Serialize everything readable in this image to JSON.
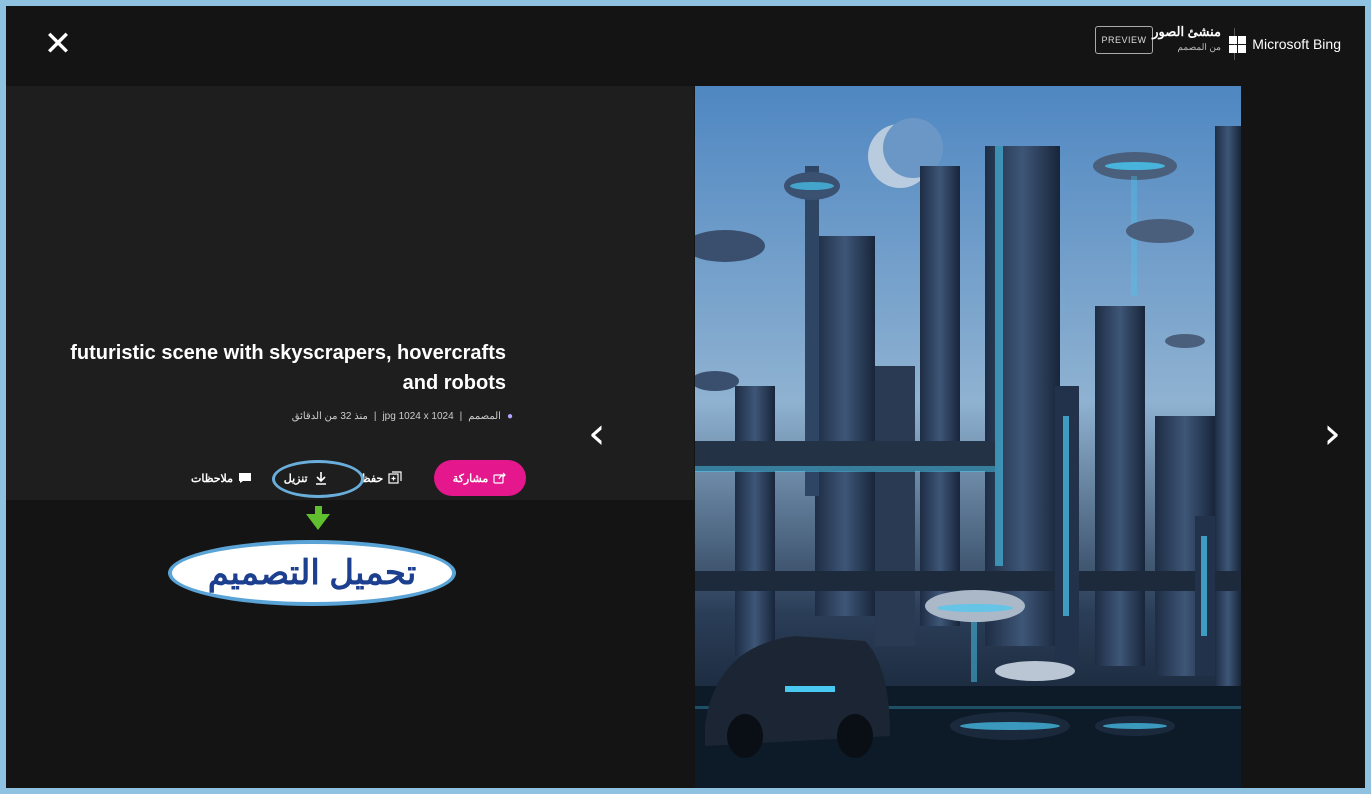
{
  "topbar": {
    "close_glyph": "✕",
    "brand_name": "Microsoft Bing",
    "gallery_title": "منشئ الصور",
    "gallery_subtitle": "من المصمم",
    "preview_label": "PREVIEW"
  },
  "details": {
    "title": "futuristic scene with skyscrapers, hovercrafts and robots",
    "meta": {
      "creator": "المصمم",
      "format": "jpg 1024 x 1024",
      "time": "منذ 32 من الدقائق"
    }
  },
  "actions": {
    "share_label": "مشاركة",
    "save_label": "حفظ",
    "download_label": "تنزيل",
    "feedback_label": "ملاحظات"
  },
  "annotation": {
    "callout_text": "تحميل التصميم"
  },
  "nav": {
    "prev_glyph": "‹",
    "next_glyph": "›"
  },
  "icons": {
    "logo": "microsoft-logo-icon",
    "share": "share-icon",
    "save": "add-collection-icon",
    "download": "download-icon",
    "feedback": "comment-icon"
  },
  "colors": {
    "share_button": "#e4178c",
    "annotation_blue": "#5aa3d6",
    "annotation_green": "#5fbf2f",
    "callout_text": "#1c3f8f"
  }
}
